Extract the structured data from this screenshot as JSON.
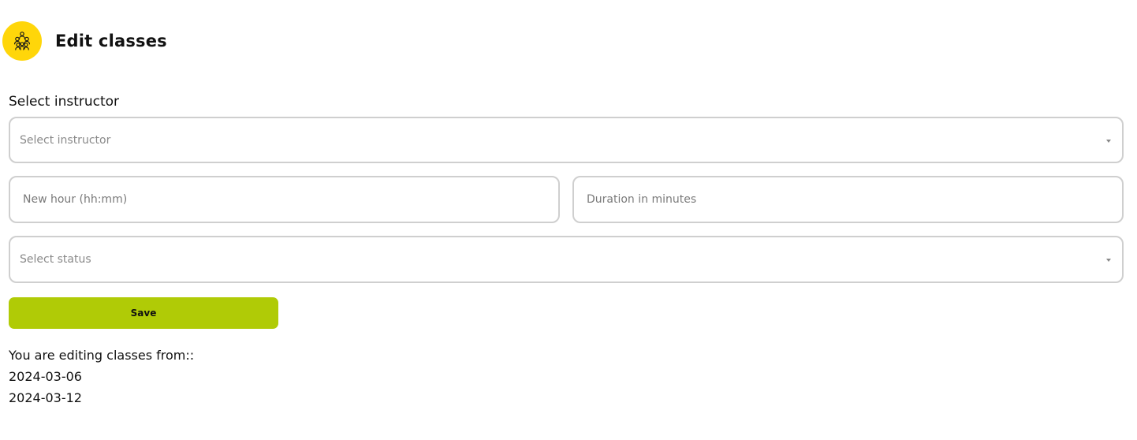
{
  "header": {
    "title": "Edit classes",
    "icon": "people-group-icon",
    "icon_bg_color": "#ffd60a"
  },
  "form": {
    "instructor_label": "Select instructor",
    "instructor_select": {
      "placeholder": "Select instructor",
      "selected": ""
    },
    "new_hour": {
      "placeholder": "New hour (hh:mm)",
      "value": ""
    },
    "duration": {
      "placeholder": "Duration in minutes",
      "value": ""
    },
    "status_select": {
      "placeholder": "Select status",
      "selected": ""
    },
    "save_label": "Save",
    "save_color": "#b0cb06"
  },
  "editing": {
    "intro": "You are editing classes from::",
    "dates": [
      "2024-03-06",
      "2024-03-12"
    ]
  }
}
